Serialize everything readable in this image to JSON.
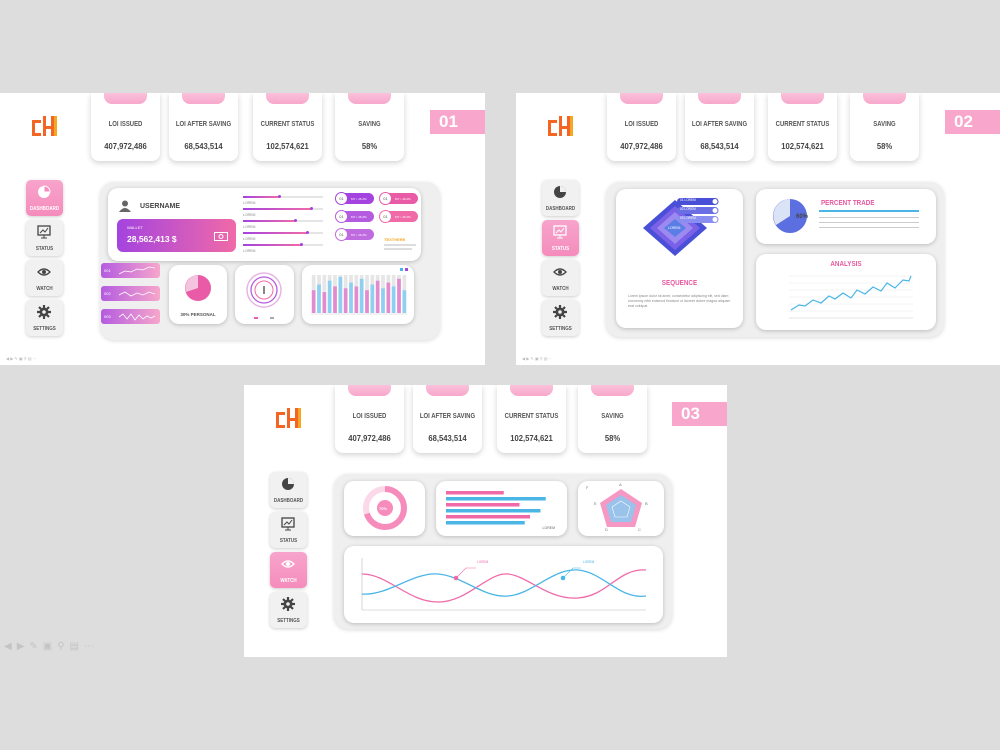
{
  "stats": {
    "loi_label": "LOI ISSUED",
    "loi_value": "407,972,486",
    "after_label": "LOI AFTER SAVING",
    "after_value": "68,543,514",
    "current_label": "CURRENT STATUS",
    "current_value": "102,574,621",
    "saving_label": "SAVING",
    "saving_value": "58%"
  },
  "nav": {
    "dashboard": "DASHBOARD",
    "status": "STATUS",
    "watch": "WATCH",
    "settings": "SETTINGS"
  },
  "slides": [
    {
      "number": "01",
      "username": "USERNAME",
      "wallet_label": "WALLET",
      "wallet_value": "28,562,413 $",
      "bars": [
        {
          "label": "LOREM",
          "value": 0.45
        },
        {
          "label": "LOREM",
          "value": 0.85
        },
        {
          "label": "LOREM",
          "value": 0.65
        },
        {
          "label": "LOREM",
          "value": 0.8
        },
        {
          "label": "LOREM",
          "value": 0.72
        }
      ],
      "badges": [
        "01",
        "01",
        "01",
        "01",
        "01"
      ],
      "badge_tag": "MY • 46.2%",
      "note_title": "TEXTHERE",
      "pills": [
        "001",
        "002",
        "003"
      ],
      "pie_caption": "30% PERSONAL",
      "column_values": [
        0.6,
        0.75,
        0.55,
        0.85,
        0.7,
        0.95,
        0.65,
        0.8,
        0.7,
        0.9,
        0.6,
        0.75,
        0.85,
        0.65,
        0.8,
        0.7,
        0.9,
        0.6
      ]
    },
    {
      "number": "02",
      "sequence_title": "SEQUENCE",
      "sequence_tags": [
        "01 LOREM",
        "02 LOREM",
        "03 LOREM"
      ],
      "sequence_center": "LOREM",
      "sequence_text": "Lorem ipsum dolor sit amet, consectetur adipiscing elit, sed diam nonummy nibh euismod tincidunt ut laoreet dolore magna aliquam erat volutpat.",
      "percent_title": "PERCENT TRADE",
      "percent_value": "60%",
      "analysis_title": "ANALYSIS"
    },
    {
      "number": "03",
      "donut_value": "70%",
      "bar_label": "LOREM",
      "radar_labels": [
        "A",
        "B",
        "C",
        "D",
        "E",
        "F"
      ],
      "wave_labels": [
        "LOREM",
        "LOREM"
      ]
    }
  ],
  "colors": {
    "pink": "#f598c4",
    "accent": "#e8579e",
    "blue": "#4ab6e6",
    "purple": "#9d47e0",
    "orange": "#f26522"
  }
}
